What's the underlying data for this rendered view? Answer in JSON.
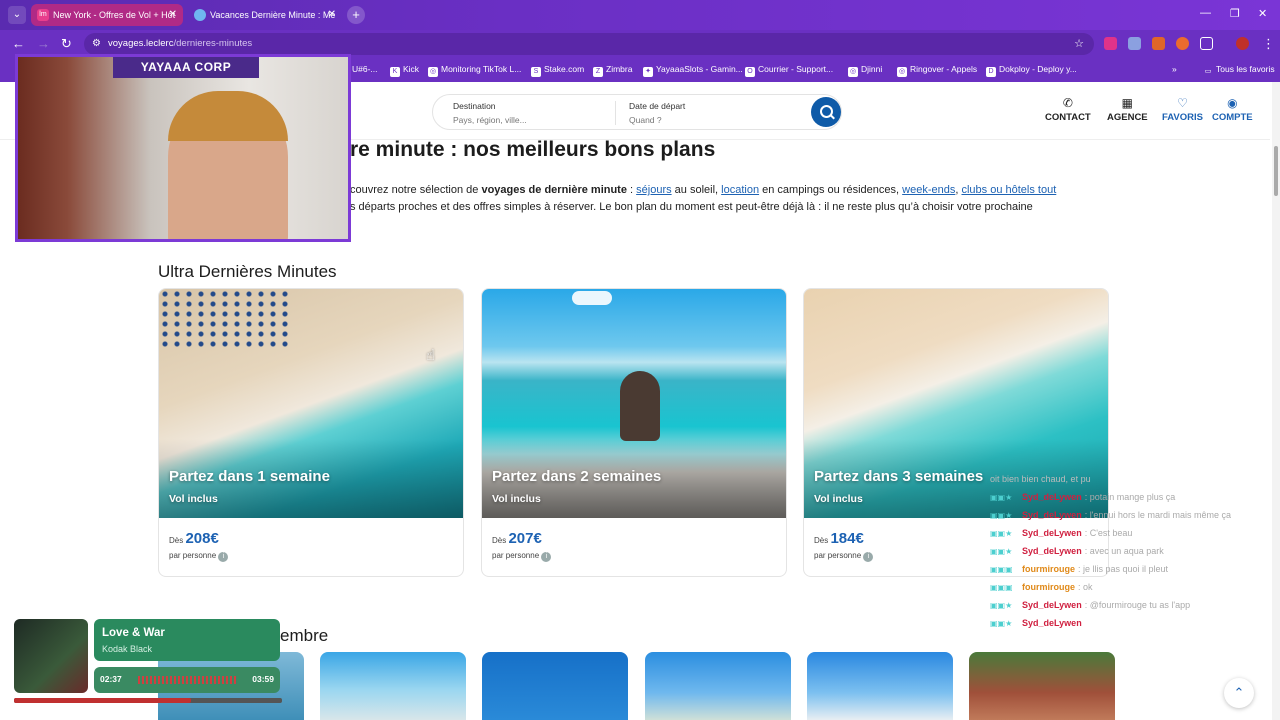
{
  "browser": {
    "tabs": [
      {
        "title": "New York - Offres de Vol + Hôt",
        "favicon": "lm"
      },
      {
        "title": "Vacances Dernière Minute : Me",
        "favicon": "leclerc-icon"
      }
    ],
    "url_host": "voyages.leclerc",
    "url_path": "/dernieres-minutes",
    "bookmarks": [
      "U#6-...",
      "Kick",
      "Monitoring TikTok L...",
      "Stake.com",
      "Zimbra",
      "YayaaaSlots - Gamin...",
      "Courrier - Support...",
      "Djinni",
      "Ringover - Appels",
      "Dokploy - Deploy y..."
    ],
    "all_tabs_label": "Tous les favoris"
  },
  "site": {
    "search": {
      "destination_label": "Destination",
      "destination_placeholder": "Pays, région, ville...",
      "date_label": "Date de départ",
      "date_placeholder": "Quand ?"
    },
    "nav": [
      {
        "label": "CONTACT",
        "icon": "phone-icon"
      },
      {
        "label": "AGENCE",
        "icon": "store-icon"
      },
      {
        "label": "FAVORIS",
        "icon": "heart-icon"
      },
      {
        "label": "COMPTE",
        "icon": "user-icon"
      }
    ]
  },
  "content": {
    "title": "re minute : nos meilleurs bons plans",
    "intro_1a": "couvrez notre sélection de ",
    "intro_1b": "voyages de dernière minute",
    "intro_1c": " : ",
    "link_sejours": "séjours",
    "intro_1d": " au soleil, ",
    "link_location": "location",
    "intro_1e": " en campings ou résidences, ",
    "link_weekends": "week-ends",
    "intro_1f": ", ",
    "link_clubs": "clubs ou hôtels tout",
    "intro_2": "s départs proches et des offres simples à réserver. Le bon plan du moment est peut-être déjà là : il ne reste plus qu’à choisir votre prochaine",
    "section_title": "Ultra Dernières Minutes",
    "cards": [
      {
        "title": "Partez dans 1 semaine",
        "subtitle": "Vol inclus",
        "from": "Dès",
        "price": "208€",
        "per": "par personne"
      },
      {
        "title": "Partez dans 2 semaines",
        "subtitle": "Vol inclus",
        "from": "Dès",
        "price": "207€",
        "per": "par personne"
      },
      {
        "title": "Partez dans 3 semaines",
        "subtitle": "Vol inclus",
        "from": "Dès",
        "price": "184€",
        "per": "par personne"
      }
    ],
    "section2_partial": "embre"
  },
  "overlay": {
    "webcam_label": "YAYAAA CORP",
    "chat_intro": "oit bien bien chaud, et pu",
    "chat": [
      {
        "user": "Syd_deLywen",
        "msg": ": potain mange plus ça"
      },
      {
        "user": "Syd_deLywen",
        "msg": ": l'ennui hors le mardi mais même ça"
      },
      {
        "user": "Syd_deLywen",
        "msg": ": C'est beau"
      },
      {
        "user": "Syd_deLywen",
        "msg": ": avec un aqua park"
      },
      {
        "user": "fourmirouge",
        "msg": ": je llis pas quoi il pleut"
      },
      {
        "user": "fourmirouge",
        "msg": ": ok"
      },
      {
        "user": "Syd_deLywen",
        "msg": ": @fourmirouge tu as l'app"
      },
      {
        "user": "Syd_deLywen",
        "msg": ""
      }
    ],
    "music": {
      "song": "Love & War",
      "artist": "Kodak Black",
      "elapsed": "02:37",
      "duration": "03:59",
      "progress": 0.66
    }
  }
}
